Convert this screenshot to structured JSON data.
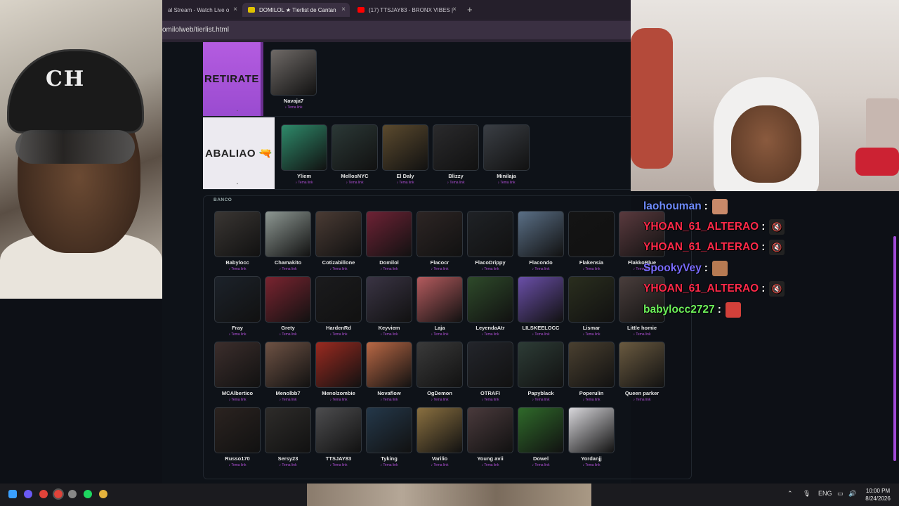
{
  "browser": {
    "tabs": [
      {
        "label": "al Stream - Watch Live o",
        "active": false,
        "fav_color": "#9b9b9b"
      },
      {
        "label": "DOMILOL ★ Tierlist de Cantan",
        "active": true,
        "fav_color": "#e0c200"
      },
      {
        "label": "(17) TTSJAY83 - BRONX VIBES |",
        "active": false,
        "fav_color": "#ff0000"
      }
    ],
    "new_tab": "+",
    "close": "×",
    "url": "omilolweb/tierlist.html"
  },
  "tiers": [
    {
      "label": "RETIRATE",
      "items": [
        {
          "name": "Navaja7",
          "link": "♪ Tema link",
          "color": "#6f6a67"
        }
      ]
    },
    {
      "label": "ABALIAO 🔫",
      "items": [
        {
          "name": "Yliem",
          "link": "♪ Tema link",
          "color": "#2e8a6a"
        },
        {
          "name": "MellosNYC",
          "link": "♪ Tema link",
          "color": "#2b3836"
        },
        {
          "name": "El Daly",
          "link": "♪ Tema link",
          "color": "#5b4a2e"
        },
        {
          "name": "Blizzy",
          "link": "♪ Tema link",
          "color": "#2a2a2c"
        },
        {
          "name": "Minilaja",
          "link": "♪ Tema link",
          "color": "#3a3e44"
        }
      ]
    }
  ],
  "banco": {
    "title": "BANCO",
    "items": [
      {
        "name": "Babylocc",
        "link": "♪ Tema link",
        "color": "#3a3633"
      },
      {
        "name": "Chamakito",
        "link": "♪ Tema link",
        "color": "#8e9893"
      },
      {
        "name": "Cotizabillone",
        "link": "♪ Tema link",
        "color": "#4a3b34"
      },
      {
        "name": "Domilol",
        "link": "♪ Tema link",
        "color": "#6e2235"
      },
      {
        "name": "Flacocr",
        "link": "♪ Tema link",
        "color": "#2d2524"
      },
      {
        "name": "FlacoDrippy",
        "link": "♪ Tema link",
        "color": "#1f2226"
      },
      {
        "name": "Flacondo",
        "link": "♪ Tema link",
        "color": "#5a6f86"
      },
      {
        "name": "Flakensia",
        "link": "♪ Tema link",
        "color": "#141414"
      },
      {
        "name": "FlakkoBlue",
        "link": "♪ Tema link",
        "color": "#5a3a3e"
      },
      {
        "name": "Fray",
        "link": "♪ Tema link",
        "color": "#1c222a"
      },
      {
        "name": "Grety",
        "link": "♪ Tema link",
        "color": "#7a2430"
      },
      {
        "name": "HardenRd",
        "link": "♪ Tema link",
        "color": "#1b1b1d"
      },
      {
        "name": "Keyviem",
        "link": "♪ Tema link",
        "color": "#3a3444"
      },
      {
        "name": "Laja",
        "link": "♪ Tema link",
        "color": "#b45b5e"
      },
      {
        "name": "LeyendaAtr",
        "link": "♪ Tema link",
        "color": "#2e4a2a"
      },
      {
        "name": "LILSKEELOCC",
        "link": "♪ Tema link",
        "color": "#6a4fa8"
      },
      {
        "name": "Lismar",
        "link": "♪ Tema link",
        "color": "#2a2e1e"
      },
      {
        "name": "Little homie",
        "link": "♪ Tema link",
        "color": "#4a3e3c"
      },
      {
        "name": "MCAlbertico",
        "link": "♪ Tema link",
        "color": "#3c2e2c"
      },
      {
        "name": "Menolbb7",
        "link": "♪ Tema link",
        "color": "#6e5244"
      },
      {
        "name": "Menolzombie",
        "link": "♪ Tema link",
        "color": "#9a2a20"
      },
      {
        "name": "Novaflow",
        "link": "♪ Tema link",
        "color": "#b96845"
      },
      {
        "name": "OgDemon",
        "link": "♪ Tema link",
        "color": "#3a3a3a"
      },
      {
        "name": "OTRAFI",
        "link": "♪ Tema link",
        "color": "#23252b"
      },
      {
        "name": "Papyblack",
        "link": "♪ Tema link",
        "color": "#2d3c36"
      },
      {
        "name": "Poperulin",
        "link": "♪ Tema link",
        "color": "#4a4030"
      },
      {
        "name": "Queen parker",
        "link": "♪ Tema link",
        "color": "#6a5a40"
      },
      {
        "name": "Russo170",
        "link": "♪ Tema link",
        "color": "#2b2320"
      },
      {
        "name": "Sersy23",
        "link": "♪ Tema link",
        "color": "#2e2c2a"
      },
      {
        "name": "TTSJAY83",
        "link": "♪ Tema link",
        "color": "#4d4d4f"
      },
      {
        "name": "Tyking",
        "link": "♪ Tema link",
        "color": "#24384a"
      },
      {
        "name": "Varilio",
        "link": "♪ Tema link",
        "color": "#8a7040"
      },
      {
        "name": "Young avii",
        "link": "♪ Tema link",
        "color": "#4a3a3c"
      },
      {
        "name": "Dowel",
        "link": "♪ Tema link",
        "color": "#2f6a2a"
      },
      {
        "name": "Yordanjj",
        "link": "♪ Tema link",
        "color": "#d9d8dc"
      }
    ]
  },
  "chat": [
    {
      "user": "laohouman",
      "color": "#6f8cff",
      "emote": "face",
      "emote_color": "#c98a6a"
    },
    {
      "user": "YHOAN_61_ALTERAO",
      "color": "#ff2a4a",
      "emote": "mute",
      "emote_color": "#222222"
    },
    {
      "user": "YHOAN_61_ALTERAO",
      "color": "#ff2a4a",
      "emote": "mute",
      "emote_color": "#222222"
    },
    {
      "user": "SpookyVey",
      "color": "#7a6cff",
      "emote": "face",
      "emote_color": "#b77a52"
    },
    {
      "user": "YHOAN_61_ALTERAO",
      "color": "#ff2a4a",
      "emote": "mute",
      "emote_color": "#222222"
    },
    {
      "user": "babylocc2727",
      "color": "#6df05a",
      "emote": "face",
      "emote_color": "#d2403a"
    }
  ],
  "chat_colon": ":",
  "mute_glyph": "🔇",
  "webcam_left": {
    "cap_text": "CH"
  },
  "taskbar": {
    "lang": "ENG",
    "time": "10:00 PM",
    "date": "8/24/2026"
  }
}
